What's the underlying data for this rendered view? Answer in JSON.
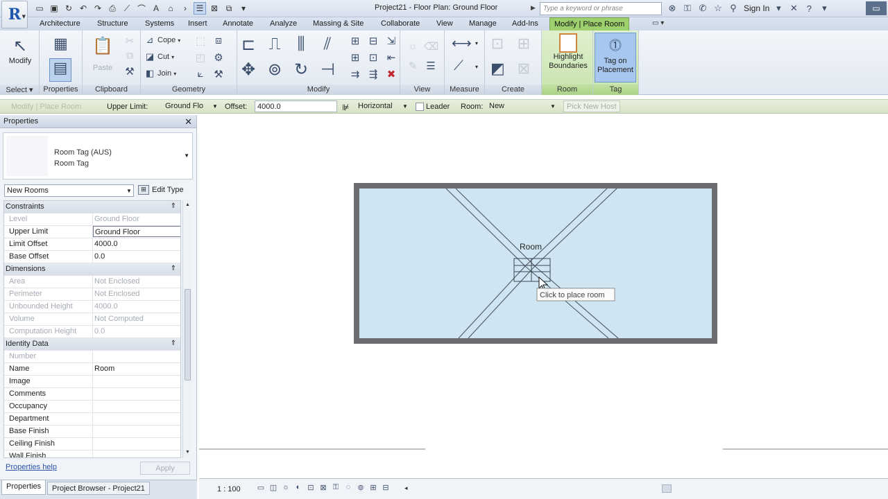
{
  "window": {
    "title": "Project21 - Floor Plan: Ground Floor",
    "search_placeholder": "Type a keyword or phrase",
    "sign_in": "Sign In"
  },
  "ribbon": {
    "tabs": [
      "Architecture",
      "Structure",
      "Systems",
      "Insert",
      "Annotate",
      "Analyze",
      "Massing & Site",
      "Collaborate",
      "View",
      "Manage",
      "Add-Ins",
      "Modify | Place Room"
    ],
    "panels": {
      "select": "Select",
      "properties": "Properties",
      "clipboard": "Clipboard",
      "geometry": "Geometry",
      "modify": "Modify",
      "view": "View",
      "measure": "Measure",
      "create": "Create",
      "room": "Room",
      "tag": "Tag"
    },
    "buttons": {
      "modify": "Modify",
      "paste": "Paste",
      "cope": "Cope",
      "cut": "Cut",
      "join": "Join",
      "highlight_boundaries_1": "Highlight",
      "highlight_boundaries_2": "Boundaries",
      "tag_on_placement_1": "Tag on",
      "tag_on_placement_2": "Placement"
    }
  },
  "options_bar": {
    "first_label": "Modify | Place Room",
    "upper_limit_label": "Upper Limit:",
    "upper_limit_value": "Ground Flo",
    "offset_label": "Offset:",
    "offset_value": "4000.0",
    "orientation_value": "Horizontal",
    "leader_label": "Leader",
    "room_label": "Room:",
    "room_value": "New",
    "pick_new_host": "Pick New Host"
  },
  "properties": {
    "title": "Properties",
    "type_family": "Room Tag (AUS)",
    "type_name": "Room Tag",
    "instance_filter": "New Rooms",
    "edit_type": "Edit Type",
    "rows": [
      {
        "section": true,
        "label": "Constraints"
      },
      {
        "label": "Level",
        "value": "Ground Floor",
        "disabled": true
      },
      {
        "label": "Upper Limit",
        "value": "Ground Floor",
        "editing": true
      },
      {
        "label": "Limit Offset",
        "value": "4000.0"
      },
      {
        "label": "Base Offset",
        "value": "0.0"
      },
      {
        "section": true,
        "label": "Dimensions"
      },
      {
        "label": "Area",
        "value": "Not Enclosed",
        "disabled": true
      },
      {
        "label": "Perimeter",
        "value": "Not Enclosed",
        "disabled": true
      },
      {
        "label": "Unbounded Height",
        "value": "4000.0",
        "disabled": true
      },
      {
        "label": "Volume",
        "value": "Not Computed",
        "disabled": true
      },
      {
        "label": "Computation Height",
        "value": "0.0",
        "disabled": true
      },
      {
        "section": true,
        "label": "Identity Data"
      },
      {
        "label": "Number",
        "value": "",
        "disabled": true
      },
      {
        "label": "Name",
        "value": "Room"
      },
      {
        "label": "Image",
        "value": ""
      },
      {
        "label": "Comments",
        "value": ""
      },
      {
        "label": "Occupancy",
        "value": ""
      },
      {
        "label": "Department",
        "value": ""
      },
      {
        "label": "Base Finish",
        "value": ""
      },
      {
        "label": "Ceiling Finish",
        "value": ""
      },
      {
        "label": "Wall Finish",
        "value": ""
      }
    ],
    "help_link": "Properties help",
    "apply": "Apply",
    "bottom_tabs": [
      "Properties",
      "Project Browser - Project21"
    ]
  },
  "canvas": {
    "room_tag_text": "Room",
    "tooltip": "Click to place room"
  },
  "status": {
    "scale": "1 : 100"
  },
  "colors": {
    "room_fill": "#cfe6f2",
    "wall": "#5e6062",
    "context_tab": "#9ed06e",
    "accent_blue": "#1f56b0"
  }
}
